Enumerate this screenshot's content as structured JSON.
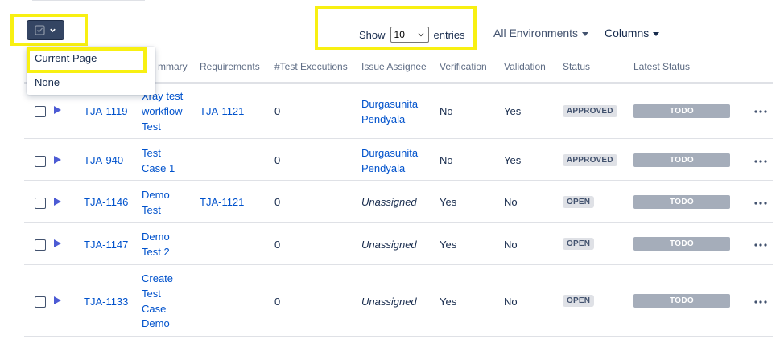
{
  "bulk_menu": {
    "items": [
      "Current Page",
      "None"
    ]
  },
  "pagination": {
    "show_label": "Show",
    "page_size": "10",
    "entries_label": "entries"
  },
  "filters": {
    "environments": "All Environments",
    "columns": "Columns"
  },
  "columns": [
    "Summary",
    "Requirements",
    "#Test Executions",
    "Issue Assignee",
    "Verification",
    "Validation",
    "Status",
    "Latest Status"
  ],
  "summary_header_visible": "mmary",
  "rows": [
    {
      "key": "TJA-1119",
      "summary": [
        "Xray test",
        "workflow",
        "Test"
      ],
      "requirement": "TJA-1121",
      "executions": "0",
      "assignee": [
        "Durgasunita",
        "Pendyala"
      ],
      "verification": "No",
      "validation": "Yes",
      "status": "APPROVED",
      "latest_status": "TODO"
    },
    {
      "key": "TJA-940",
      "summary": [
        "Test",
        "Case 1"
      ],
      "requirement": "",
      "executions": "0",
      "assignee": [
        "Durgasunita",
        "Pendyala"
      ],
      "verification": "No",
      "validation": "Yes",
      "status": "APPROVED",
      "latest_status": "TODO"
    },
    {
      "key": "TJA-1146",
      "summary": [
        "Demo",
        "Test"
      ],
      "requirement": "TJA-1121",
      "executions": "0",
      "assignee": [
        "Unassigned"
      ],
      "verification": "Yes",
      "validation": "No",
      "status": "OPEN",
      "latest_status": "TODO"
    },
    {
      "key": "TJA-1147",
      "summary": [
        "Demo",
        "Test 2"
      ],
      "requirement": "",
      "executions": "0",
      "assignee": [
        "Unassigned"
      ],
      "verification": "Yes",
      "validation": "No",
      "status": "OPEN",
      "latest_status": "TODO"
    },
    {
      "key": "TJA-1133",
      "summary": [
        "Create",
        "Test",
        "Case",
        "Demo"
      ],
      "requirement": "",
      "executions": "0",
      "assignee": [
        "Unassigned"
      ],
      "verification": "Yes",
      "validation": "No",
      "status": "OPEN",
      "latest_status": "TODO"
    }
  ],
  "colors": {
    "link": "#0052cc",
    "highlight": "#f8f012",
    "bulk_button": "#344563",
    "lozenge": "#dfe1e6",
    "todo": "#a5adba",
    "play": "#4c5bd4"
  },
  "icons": {
    "bulk_select": "checkbox-icon",
    "play": "play-icon",
    "more": "more-icon",
    "select_arrow": "chevron-down-icon"
  }
}
